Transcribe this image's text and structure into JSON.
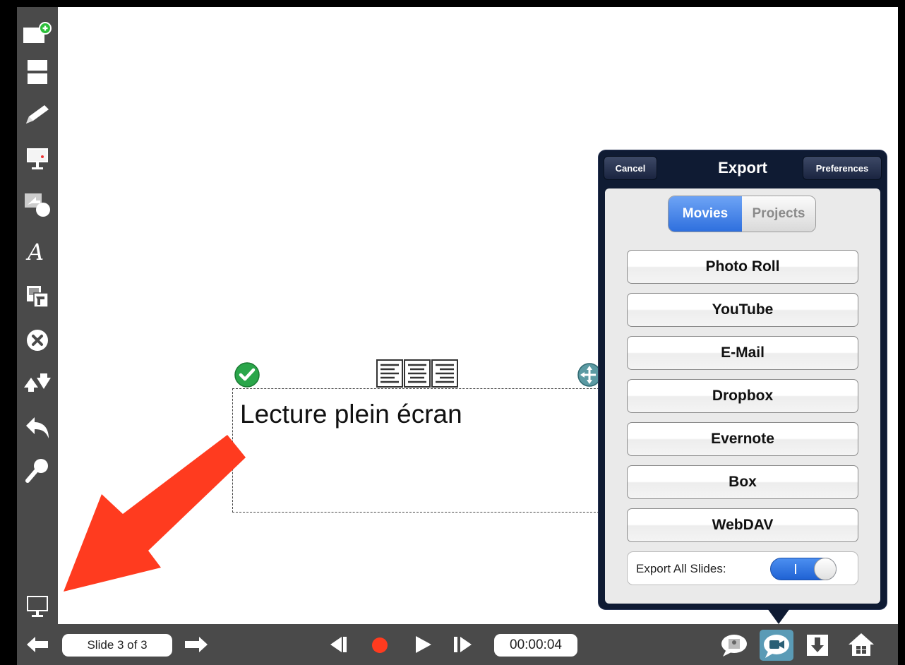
{
  "canvas": {
    "text_box": {
      "text": "Lecture plein écran"
    }
  },
  "bottombar": {
    "slide_indicator": "Slide 3 of 3",
    "timer": "00:00:04",
    "record_color": "#ff3b1f"
  },
  "popover": {
    "title": "Export",
    "cancel_label": "Cancel",
    "preferences_label": "Preferences",
    "segments": [
      {
        "label": "Movies",
        "selected": true
      },
      {
        "label": "Projects",
        "selected": false
      }
    ],
    "options": [
      "Photo Roll",
      "YouTube",
      "E-Mail",
      "Dropbox",
      "Evernote",
      "Box",
      "WebDAV"
    ],
    "export_all_slides": {
      "label": "Export All Slides:",
      "on": true,
      "on_text": "I"
    }
  },
  "annotation": {
    "arrow_color": "#ff3b1f"
  },
  "sidebar": {
    "icons": [
      "new-slide-icon",
      "layout-icon",
      "pencil-icon",
      "presentation-icon",
      "shapes-icon",
      "text-font-icon",
      "insert-image-icon",
      "delete-icon",
      "arrange-icon",
      "undo-icon",
      "zoom-icon",
      "projector-icon"
    ]
  },
  "accent_colors": {
    "popover_bg": "#0f1b33",
    "toggle_on": "#2e6fde",
    "toolbar_bg": "#4a4a4a"
  }
}
